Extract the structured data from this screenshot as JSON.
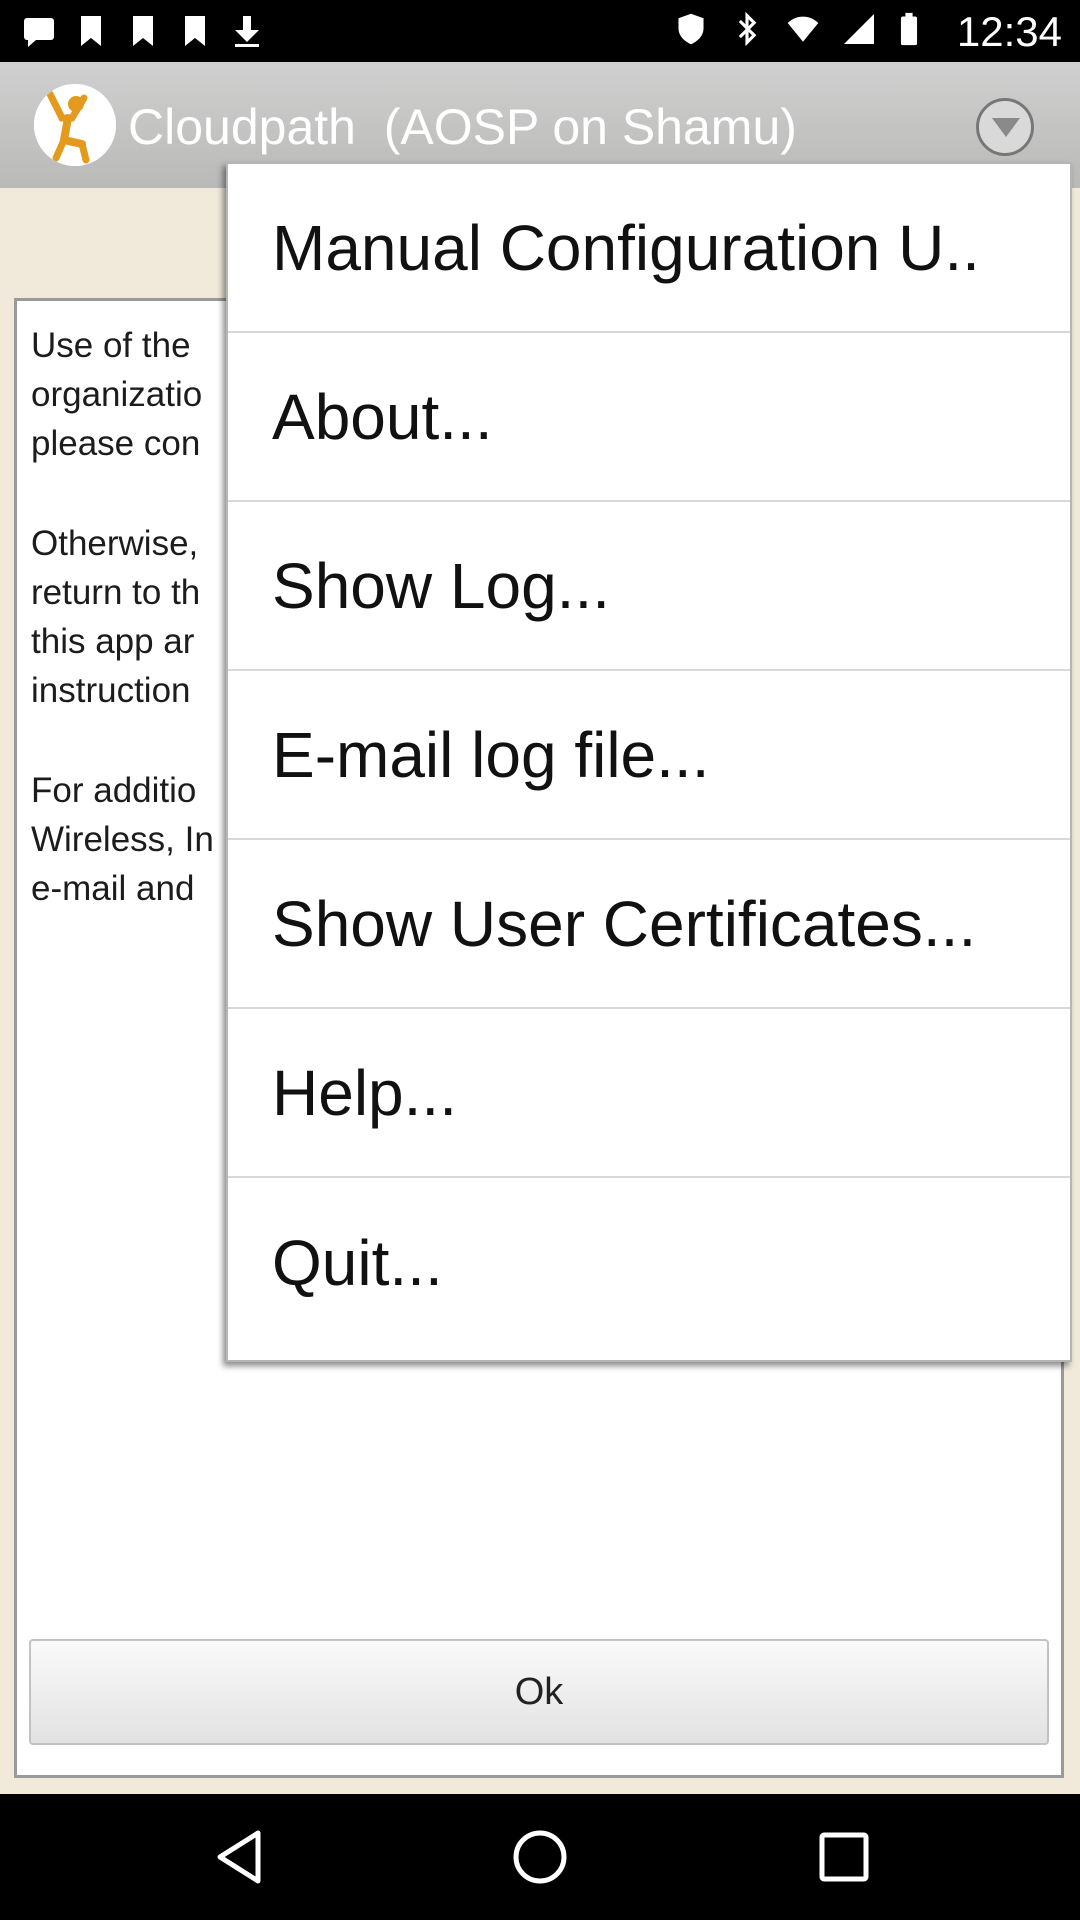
{
  "status_bar": {
    "time": "12:34",
    "icons_left": [
      "message-icon",
      "bookmark-icon",
      "bookmark-icon",
      "bookmark-icon",
      "download-icon"
    ],
    "icons_right": [
      "shield-icon",
      "bluetooth-icon",
      "wifi-icon",
      "signal-icon",
      "battery-icon"
    ]
  },
  "app_bar": {
    "title": "Cloudpath  (AOSP on Shamu)",
    "logo_icon": "cloudpath-person-icon",
    "overflow_icon": "chevron-down-circle-icon",
    "accent": "#e49a1c"
  },
  "content": {
    "paragraphs": [
      [
        "Use of the",
        "organizatio",
        "please con"
      ],
      [
        "Otherwise,",
        "return to th",
        "this app ar",
        "instruction"
      ],
      [
        "For additio",
        "Wireless, In",
        "e-mail and"
      ]
    ],
    "ok_label": "Ok",
    "background": "#f1eadb"
  },
  "menu": {
    "items": [
      "Manual Configuration U..",
      "About...",
      "Show Log...",
      "E-mail log file...",
      "Show User Certificates...",
      "Help...",
      "Quit..."
    ]
  },
  "nav_bar": {
    "icons": [
      "back-icon",
      "home-icon",
      "recents-icon"
    ]
  }
}
